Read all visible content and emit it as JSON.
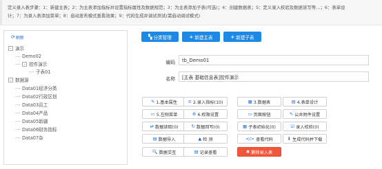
{
  "banner": {
    "line1": "定义录入表步骤：1：新建主表；2：为主表添加指标并设置指标属性及数据规范；3：为主表添加子表(可选)；4：创建数据表；5：定义录入校验及数据读写等…；6：表单设",
    "line2": "计；7：为录入表添加菜单；8：启动发布模式查看效果；9：代码生成并调试测试(需启动调试模式)"
  },
  "tree": {
    "refresh_label": "刷新",
    "nodes": [
      {
        "label": "演示",
        "toggle": "-"
      },
      {
        "label": "Demo02",
        "toggle": ""
      },
      {
        "label": "控件演示",
        "toggle": "-"
      },
      {
        "label": "子表01",
        "toggle": ""
      },
      {
        "label": "数据源",
        "toggle": "-"
      },
      {
        "label": "Data01经济分类",
        "toggle": ""
      },
      {
        "label": "Data02行政区划",
        "toggle": ""
      },
      {
        "label": "Data03员工",
        "toggle": ""
      },
      {
        "label": "Data04产品",
        "toggle": ""
      },
      {
        "label": "Data05新疆",
        "toggle": ""
      },
      {
        "label": "Data06财务指标",
        "toggle": ""
      },
      {
        "label": "Data07杂",
        "toggle": ""
      }
    ]
  },
  "toolbar": {
    "category": "分类管理",
    "new_main": "新建主表",
    "new_sub": "新建子表"
  },
  "form": {
    "code_label": "编码",
    "code_value": "tb_Demo01",
    "name_label": "名称",
    "name_value": "[主表 基础信息表]控件演示"
  },
  "actions": [
    [
      "1.基本属性",
      "2.录入指标(10)",
      "3.数据表",
      "4.表单设计"
    ],
    [
      "5.左侧菜单",
      "6.权限设置",
      "页面按钮",
      "公共附件设置"
    ],
    [
      "数据读取(0)",
      "数据回写(0)",
      "子表初始化(0)",
      "录入校验(0)"
    ],
    [
      "数据导入",
      "检 测",
      "查看代码",
      "生成代码并下载"
    ],
    [
      "数据交互",
      "记录查看",
      "删除录入表"
    ]
  ],
  "action_icons": [
    [
      "✎",
      "≡",
      "▦",
      "▤"
    ],
    [
      "▭",
      "⚙",
      "▭",
      "✎"
    ],
    [
      "⇄",
      "↻",
      "▦",
      "☑"
    ],
    [
      "▤",
      "▲",
      "</>",
      "⬇"
    ],
    [
      "🔍",
      "▤",
      "✖"
    ]
  ]
}
